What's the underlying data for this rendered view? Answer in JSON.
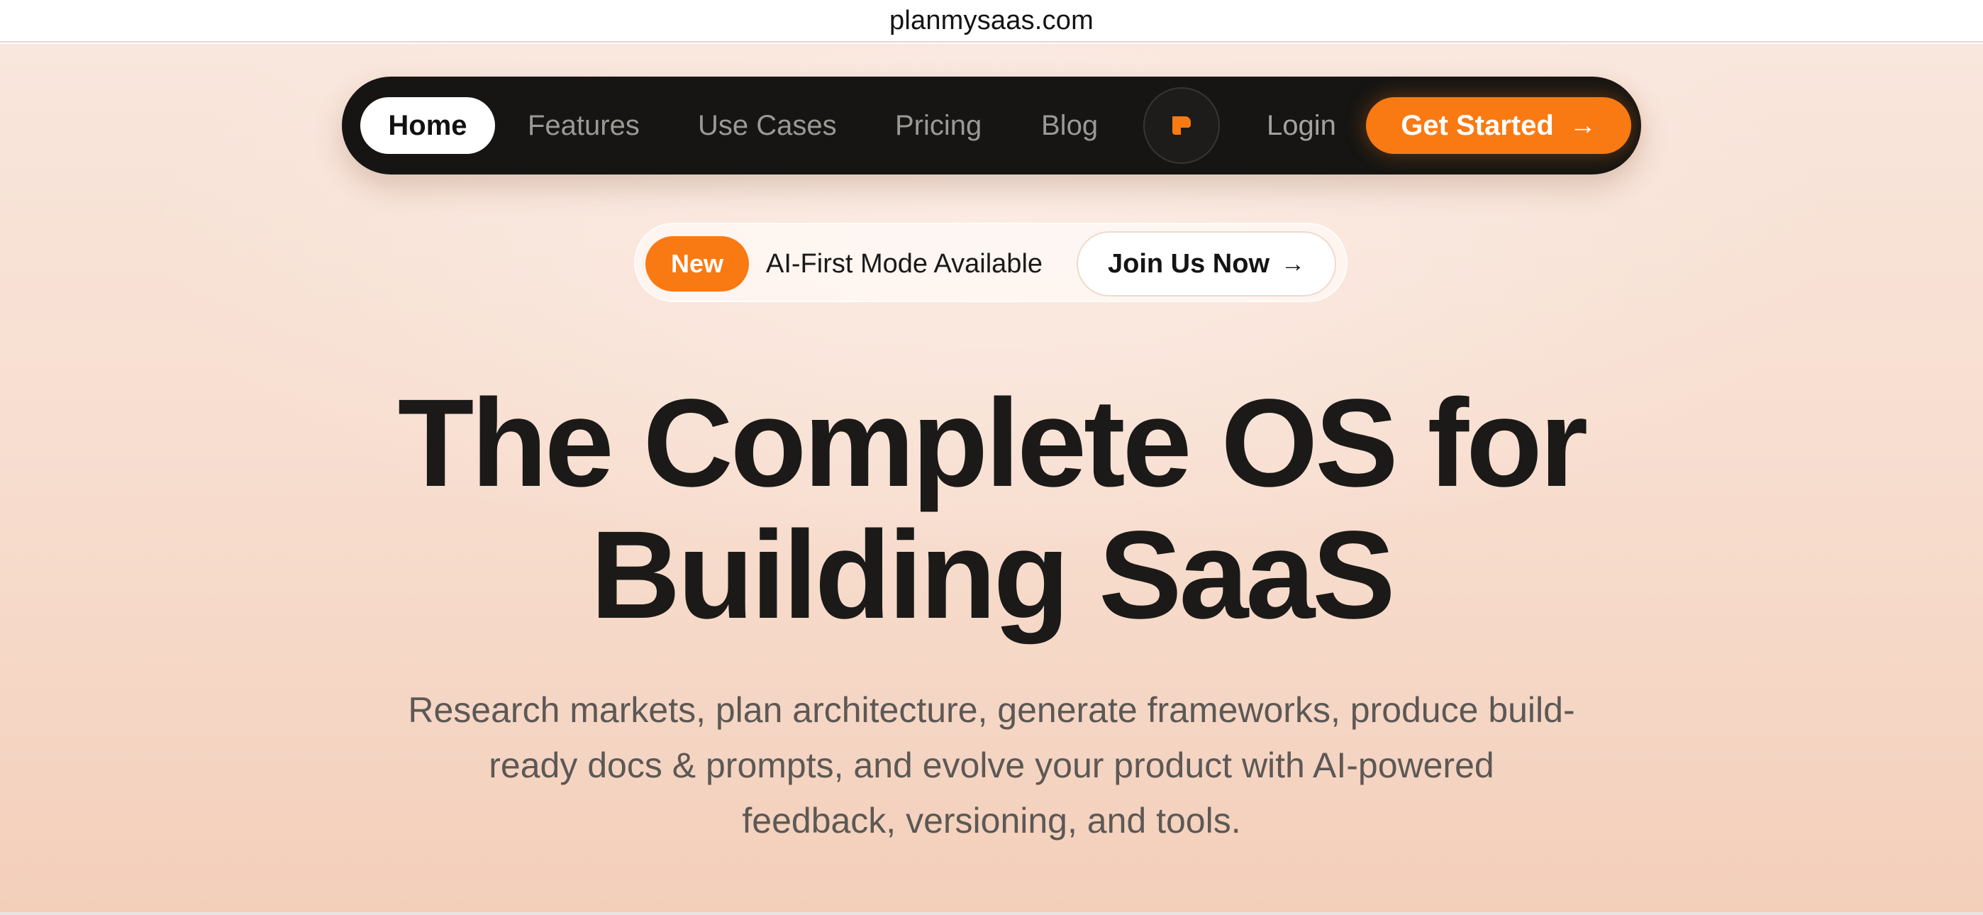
{
  "browser": {
    "url": "planmysaas.com"
  },
  "nav": {
    "items": [
      {
        "label": "Home",
        "active": true
      },
      {
        "label": "Features"
      },
      {
        "label": "Use Cases"
      },
      {
        "label": "Pricing"
      },
      {
        "label": "Blog"
      }
    ],
    "logo_icon": "planmysaas-logo-icon",
    "login_label": "Login",
    "cta_label": "Get Started",
    "cta_icon": "arrow-right-icon"
  },
  "announcement": {
    "badge": "New",
    "text": "AI-First Mode Available",
    "button_label": "Join Us Now",
    "button_icon": "arrow-right-icon"
  },
  "hero": {
    "title_line1": "The Complete OS for",
    "title_line2": "Building SaaS",
    "subtitle_line1": "Research markets, plan architecture, generate frameworks, produce build-",
    "subtitle_line2": "ready docs & prompts, and evolve your product with AI-powered",
    "subtitle_line3": "feedback, versioning, and tools."
  },
  "colors": {
    "accent": "#f97a12",
    "nav_bg": "#161513",
    "page_bg_top": "#f9e6dc",
    "page_bg_bottom": "#f3cfba",
    "text_dark": "#1b1a18",
    "text_muted": "#5c5855"
  }
}
